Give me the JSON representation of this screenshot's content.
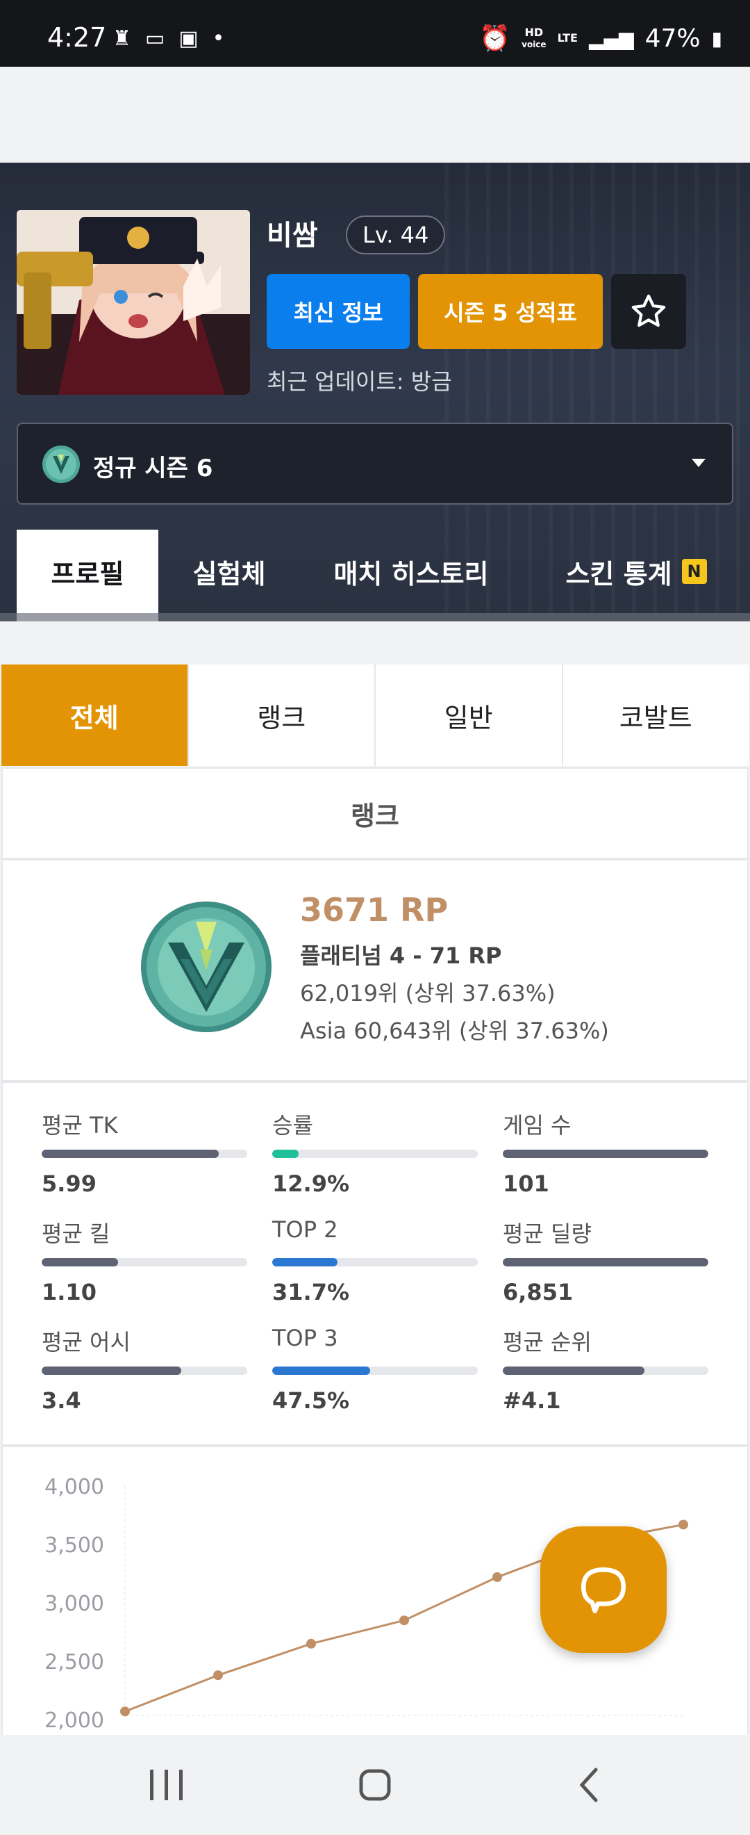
{
  "status_bar": {
    "time": "4:27",
    "battery": "47%",
    "hd_top": "HD",
    "hd_bottom": "voice",
    "lte": "LTE"
  },
  "profile": {
    "name": "비쌈",
    "level": "Lv. 44",
    "btn_latest": "최신 정보",
    "btn_season": "시즌 5 성적표",
    "updated": "최근 업데이트: 방금",
    "season_select": "정규 시즌 6"
  },
  "tabs": [
    {
      "label": "프로필"
    },
    {
      "label": "실험체"
    },
    {
      "label": "매치 히스토리"
    },
    {
      "label": "스킨 통계",
      "badge": "N"
    }
  ],
  "filters": [
    "전체",
    "랭크",
    "일반",
    "코발트"
  ],
  "rank": {
    "section_title": "랭크",
    "rp": "3671 RP",
    "tier": "플래티넘 4 - 71 RP",
    "global_rank": "62,019위 (상위 37.63%)",
    "region_rank": "Asia 60,643위 (상위 37.63%)"
  },
  "stats": [
    {
      "label": "평균 TK",
      "value": "5.99",
      "fill": 0.86,
      "color": "#5f6273"
    },
    {
      "label": "승률",
      "value": "12.9%",
      "fill": 0.129,
      "color": "#1fbf9a"
    },
    {
      "label": "게임 수",
      "value": "101",
      "fill": 1.0,
      "color": "#5f6273"
    },
    {
      "label": "평균 킬",
      "value": "1.10",
      "fill": 0.37,
      "color": "#5f6273"
    },
    {
      "label": "TOP 2",
      "value": "31.7%",
      "fill": 0.317,
      "color": "#2b78d2"
    },
    {
      "label": "평균 딜량",
      "value": "6,851",
      "fill": 1.0,
      "color": "#5f6273"
    },
    {
      "label": "평균 어시",
      "value": "3.4",
      "fill": 0.68,
      "color": "#5f6273"
    },
    {
      "label": "TOP 3",
      "value": "47.5%",
      "fill": 0.475,
      "color": "#2b78d2"
    },
    {
      "label": "평균 순위",
      "value": "#4.1",
      "fill": 0.69,
      "color": "#5f6273"
    }
  ],
  "chart_data": {
    "type": "line",
    "y_ticks": [
      "4,000",
      "3,500",
      "3,000",
      "2,500",
      "2,000"
    ],
    "ylim": [
      2000,
      4000
    ],
    "series": [
      {
        "values": [
          2070,
          2380,
          2650,
          2850,
          3220,
          3520,
          3670
        ]
      }
    ],
    "color": "#c08f66"
  }
}
